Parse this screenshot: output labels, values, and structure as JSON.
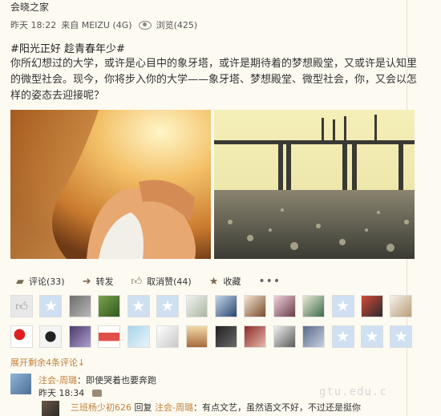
{
  "post": {
    "author": "会晓之家",
    "time": "昨天 18:22",
    "source": "来自 MEIZU (4G)",
    "views": "浏览(425)",
    "topic": "#阳光正好 趁青春年少#",
    "text": "你所幻想过的大学，或许是心目中的象牙塔，或许是期待着的梦想殿堂，又或许是认知里的微型社会。现今，你将步入你的大学——象牙塔、梦想殿堂、微型社会，你，又会以怎样的姿态去迎接呢？"
  },
  "actions": {
    "comment": "评论(33)",
    "repost": "转发",
    "unlike": "取消赞(44)",
    "favorite": "收藏",
    "more": "•••"
  },
  "expand_comments": "展开剩余4条评论↓",
  "comment": {
    "author": "注会-周璐",
    "text": "：即使哭着也要奔跑",
    "time": "昨天 18:34"
  },
  "reply": {
    "author": "三班杨少初626",
    "action": "回复",
    "target": "注会-周璐",
    "text": "：有点文艺，虽然语文不好，不过还是挺你"
  },
  "watermark": "gtu.edu.c",
  "colors": {
    "accent": "#c0813a",
    "background": "#fdfaf1",
    "star_avatar": "#cfe0f2"
  }
}
